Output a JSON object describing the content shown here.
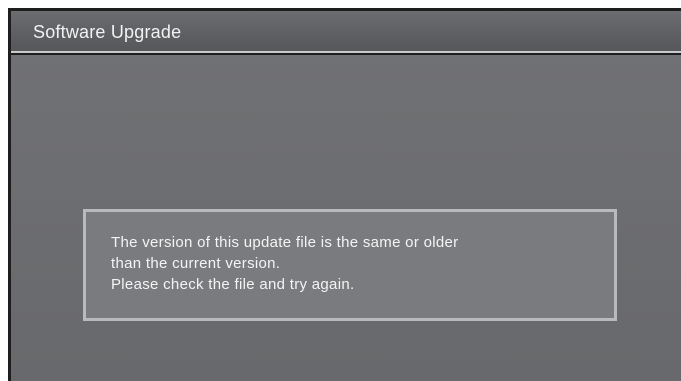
{
  "window": {
    "title": "Software Upgrade"
  },
  "dialog": {
    "lines": [
      "The version of this update file is the same or older",
      "than the current version.",
      "Please check the file and try again."
    ]
  },
  "colors": {
    "title_bar": "#626366",
    "content_background": "#6c6d70",
    "message_box_background": "#7a7b7e",
    "message_box_border": "#b9babc",
    "text": "#f2f2f2"
  }
}
